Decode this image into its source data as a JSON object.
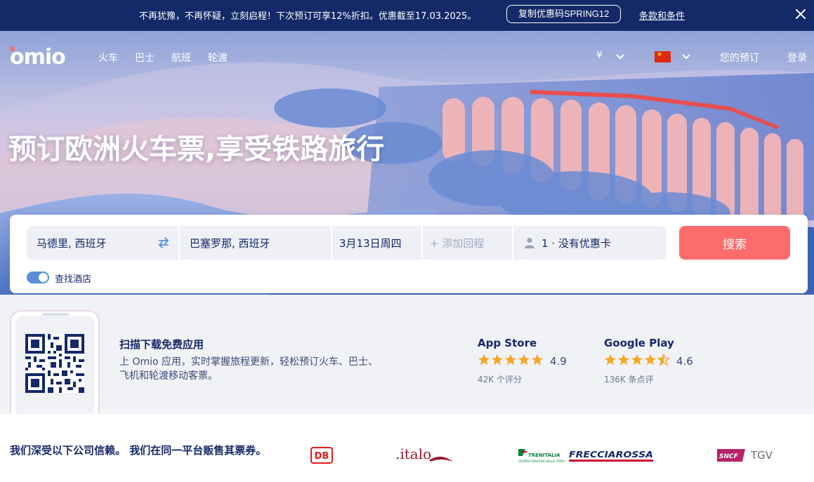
{
  "promo": {
    "text": "不再犹豫，不再怀疑，立刻启程！下次预订可享12%折扣。优惠截至17.03.2025。",
    "code_button": "复制优惠码SPRING12",
    "terms_link": "条款和条件"
  },
  "nav": {
    "logo": "omio",
    "links": [
      "火车",
      "巴士",
      "航班",
      "轮渡"
    ],
    "currency": "¥",
    "my_bookings": "您的预订",
    "login": "登录"
  },
  "hero": {
    "headline": "预订欧洲火车票,享受铁路旅行"
  },
  "search": {
    "from": "马德里, 西班牙",
    "to": "巴塞罗那, 西班牙",
    "date": "3月13日周四",
    "return_placeholder": "+ 添加回程",
    "passengers": "1 · 没有优惠卡",
    "search_button": "搜索",
    "hotel_toggle_label": "查找酒店",
    "hotel_toggle_on": true
  },
  "app_promo": {
    "title": "扫描下载免费应用",
    "description": "上 Omio 应用，实时掌握旅程更新，轻松预订火车、巴士、飞机和轮渡移动客票。",
    "stores": [
      {
        "name": "App Store",
        "rating": "4.9",
        "stars": 5,
        "count": "42K 个评分"
      },
      {
        "name": "Google Play",
        "rating": "4.6",
        "stars": 4.5,
        "count": "136K 条点评"
      }
    ]
  },
  "trusted": {
    "text": "我们深受以下公司信赖。 我们在同一平台贩售其票券。",
    "partners": [
      "DB",
      ".italo",
      "TRENITALIA",
      "FRECCIAROSSA",
      "SNCF",
      "TGV"
    ]
  },
  "colors": {
    "navy": "#132968",
    "accent": "#fc6c6c",
    "toggle": "#5a8fd6",
    "star": "#f5a623"
  }
}
